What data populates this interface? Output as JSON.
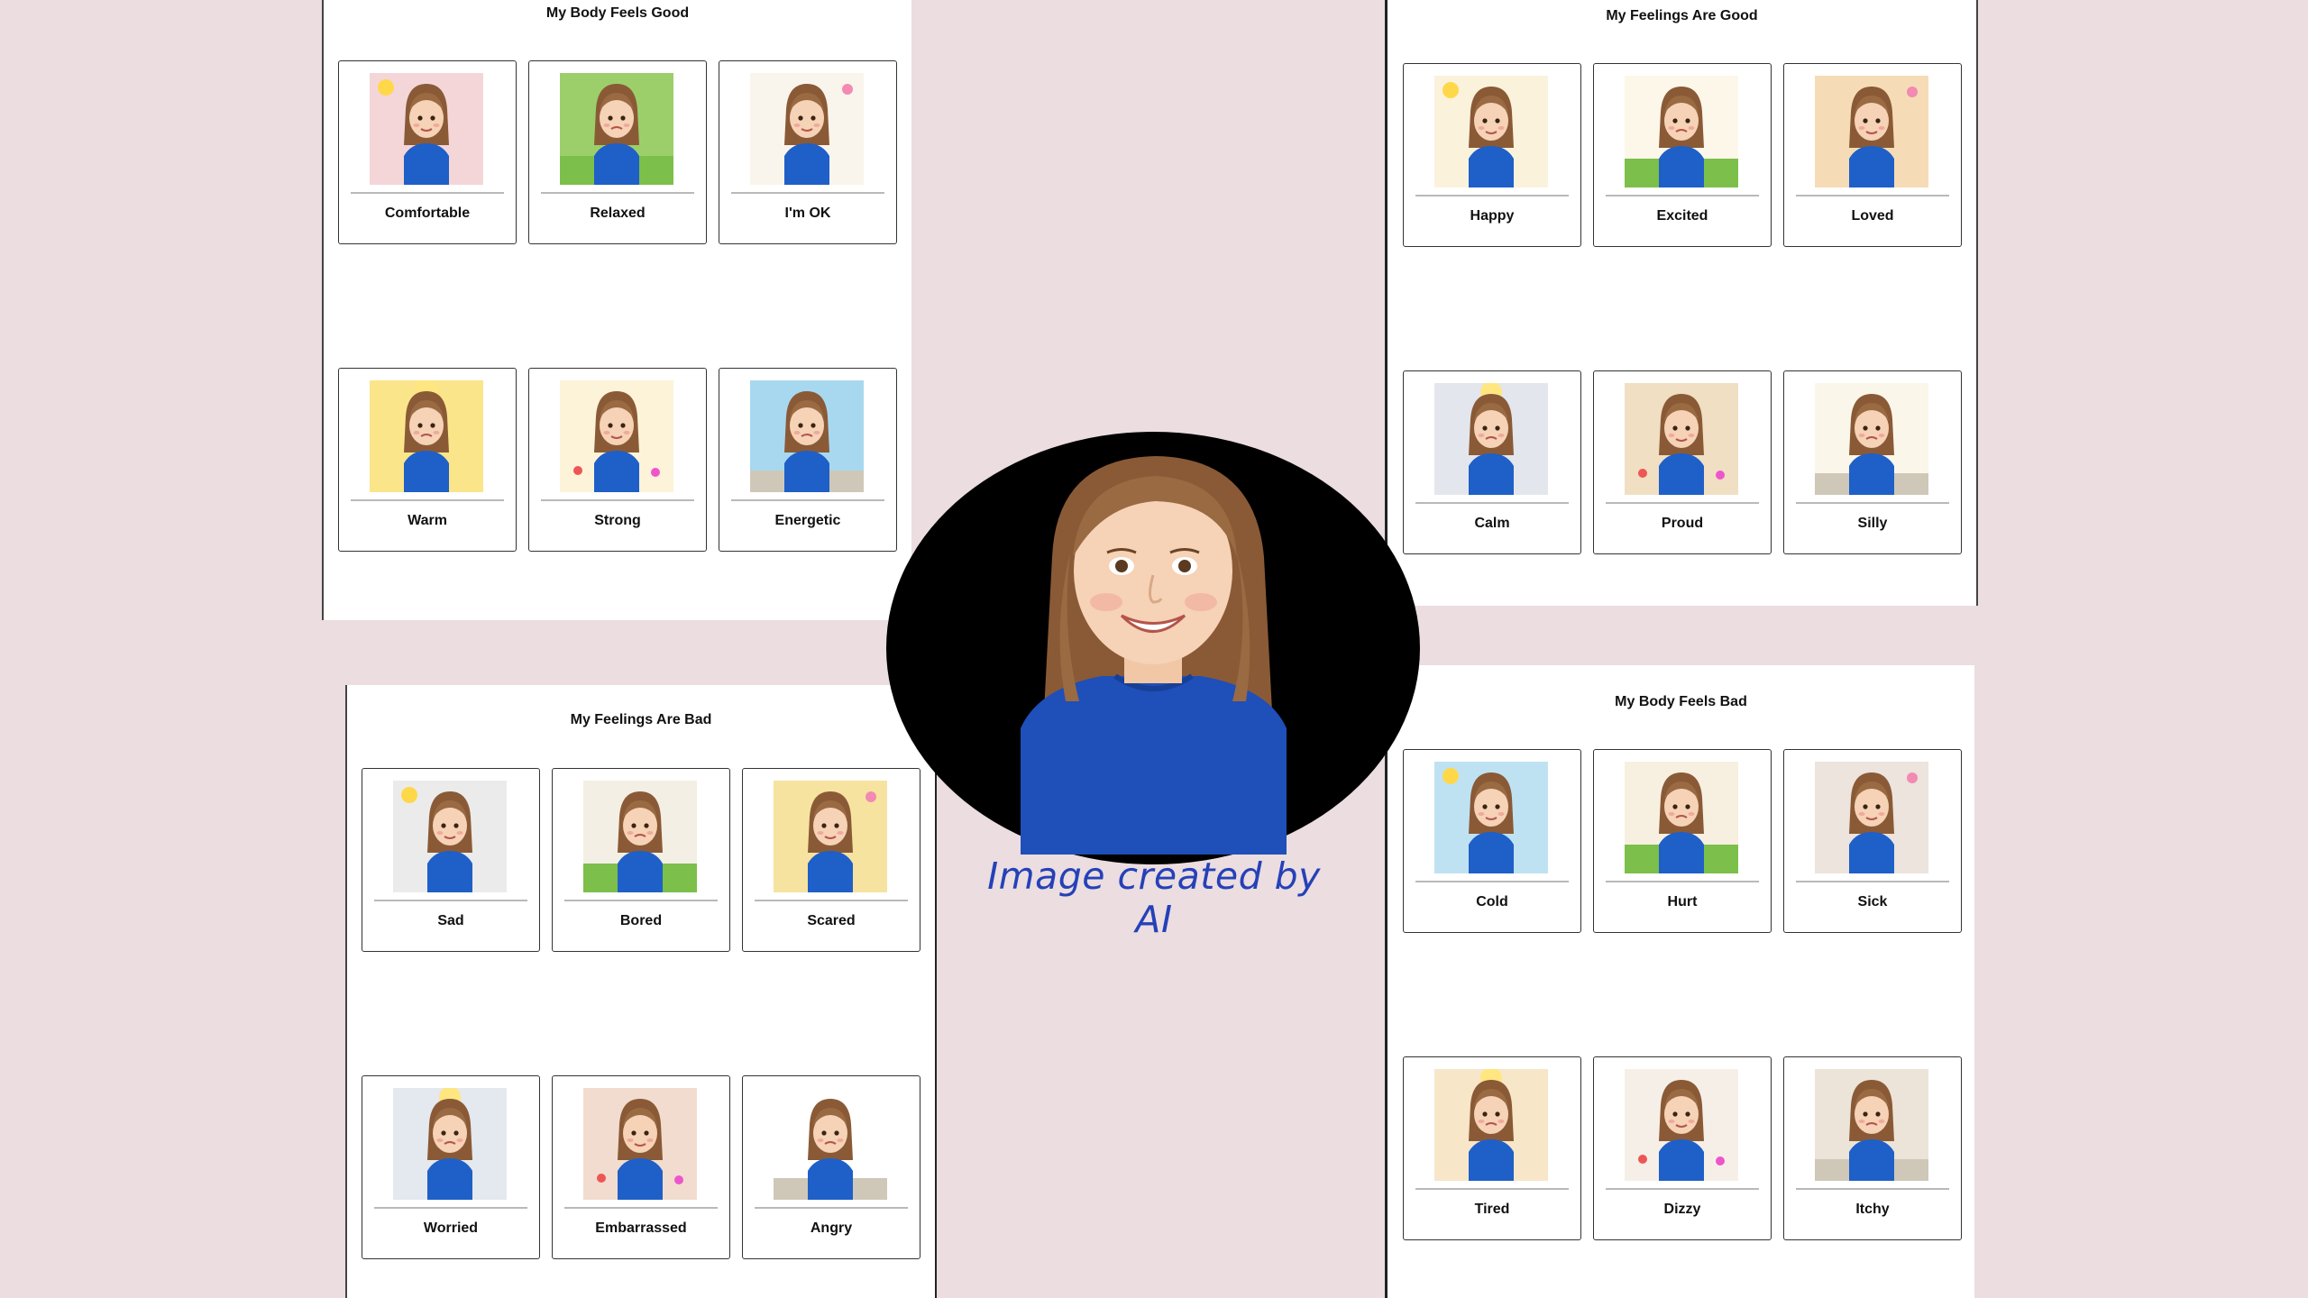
{
  "panels": {
    "body_good": {
      "title": "My Body Feels Good",
      "cards": [
        {
          "label": "Comfortable",
          "icon": "girl-in-bed-icon",
          "bg": "#f4d6d9"
        },
        {
          "label": "Relaxed",
          "icon": "girl-lying-on-grass-icon",
          "bg": "#9ccf6a"
        },
        {
          "label": "I'm OK",
          "icon": "girl-standing-icon",
          "bg": "#faf5ec"
        },
        {
          "label": "Warm",
          "icon": "girl-in-sunshine-icon",
          "bg": "#fbe58a"
        },
        {
          "label": "Strong",
          "icon": "girl-flexing-icon",
          "bg": "#fdf3d8"
        },
        {
          "label": "Energetic",
          "icon": "girl-jumping-icon",
          "bg": "#a8d8ef"
        }
      ]
    },
    "feelings_good": {
      "title": "My Feelings Are Good",
      "cards": [
        {
          "label": "Happy",
          "icon": "girl-happy-icon",
          "bg": "#fbf2dc"
        },
        {
          "label": "Excited",
          "icon": "girl-excited-balloons-icon",
          "bg": "#fdf7ea"
        },
        {
          "label": "Loved",
          "icon": "girl-hugging-icon",
          "bg": "#f6dcb6"
        },
        {
          "label": "Calm",
          "icon": "girl-by-window-icon",
          "bg": "#e3e6ec"
        },
        {
          "label": "Proud",
          "icon": "girl-proud-icon",
          "bg": "#f0dfc2"
        },
        {
          "label": "Silly",
          "icon": "girl-silly-icon",
          "bg": "#fbf6ea"
        }
      ]
    },
    "feelings_bad": {
      "title": "My Feelings Are Bad",
      "cards": [
        {
          "label": "Sad",
          "icon": "girl-sad-icon",
          "bg": "#ebebeb"
        },
        {
          "label": "Bored",
          "icon": "girl-bored-icon",
          "bg": "#f4efe4"
        },
        {
          "label": "Scared",
          "icon": "girl-scared-icon",
          "bg": "#f7e3a0"
        },
        {
          "label": "Worried",
          "icon": "girl-worried-icon",
          "bg": "#e4e8ef"
        },
        {
          "label": "Embarrassed",
          "icon": "girl-embarrassed-icon",
          "bg": "#f2dccf"
        },
        {
          "label": "Angry",
          "icon": "girl-angry-icon",
          "bg": "#ffffff"
        }
      ]
    },
    "body_bad": {
      "title": "My Body Feels Bad",
      "cards": [
        {
          "label": "Cold",
          "icon": "girl-cold-icon",
          "bg": "#bfe2f2"
        },
        {
          "label": "Hurt",
          "icon": "girl-hurt-icon",
          "bg": "#f7f0e0"
        },
        {
          "label": "Sick",
          "icon": "girl-sick-icon",
          "bg": "#ece4dd"
        },
        {
          "label": "Tired",
          "icon": "girl-tired-icon",
          "bg": "#f7e6c8"
        },
        {
          "label": "Dizzy",
          "icon": "girl-dizzy-icon",
          "bg": "#f6efe8"
        },
        {
          "label": "Itchy",
          "icon": "girl-itchy-icon",
          "bg": "#ece4d8"
        }
      ]
    }
  },
  "portrait": {
    "icon": "smiling-girl-portrait-icon",
    "caption": "Image created by AI",
    "shirt_color": "#1f4fb8"
  },
  "colors": {
    "background": "#ebdde0",
    "caption": "#2541b8",
    "card_border": "#333333"
  }
}
